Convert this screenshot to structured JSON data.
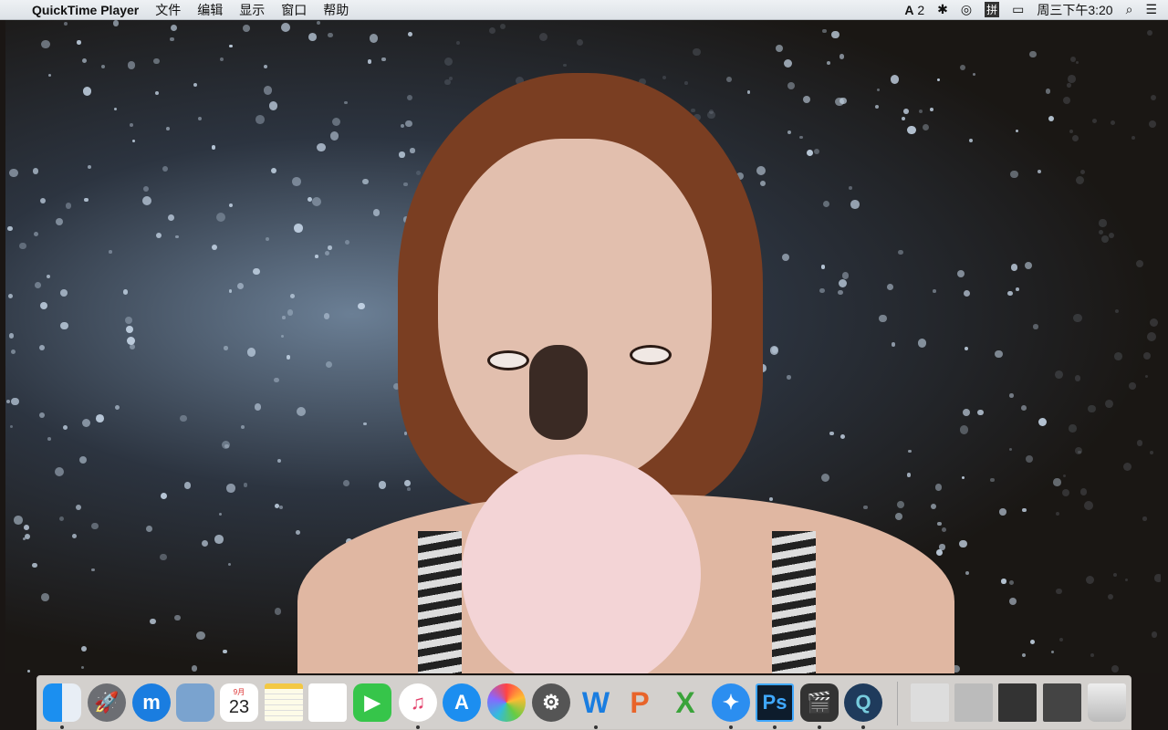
{
  "menubar": {
    "app_name": "QuickTime Player",
    "menus": [
      "文件",
      "编辑",
      "显示",
      "窗口",
      "帮助"
    ],
    "status": {
      "adobe": "2",
      "input_method": "拼",
      "clock": "周三下午3:20"
    }
  },
  "dock": {
    "calendar_month": "9月",
    "calendar_day": "23",
    "apps": [
      "finder",
      "launchpad",
      "maxthon",
      "mail",
      "calendar",
      "notes",
      "reminders",
      "facetime",
      "itunes",
      "app-store",
      "photos",
      "system-preferences",
      "word",
      "powerpoint",
      "excel",
      "safari",
      "photoshop",
      "final-cut-pro",
      "quicktime"
    ],
    "letters": {
      "word": "W",
      "powerpoint": "P",
      "excel": "X",
      "photoshop": "Ps",
      "quicktime": "Q"
    }
  }
}
